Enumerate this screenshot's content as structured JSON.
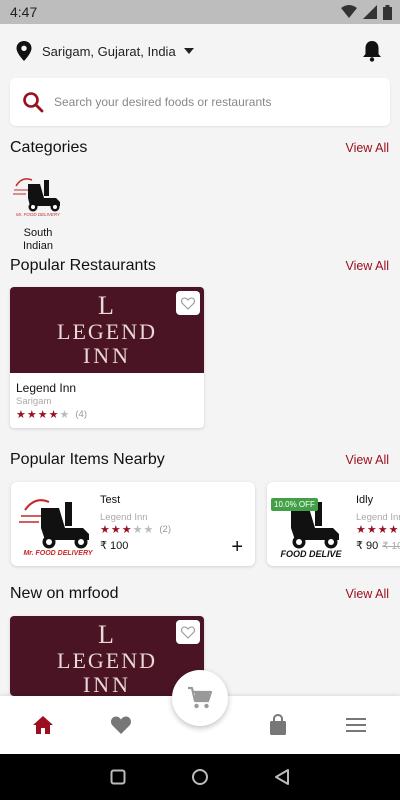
{
  "status": {
    "time": "4:47"
  },
  "header": {
    "location": "Sarigam, Gujarat, India"
  },
  "search": {
    "placeholder": "Search your desired foods or restaurants"
  },
  "sections": {
    "categories": "Categories",
    "popular_restaurants": "Popular Restaurants",
    "popular_items": "Popular Items Nearby",
    "new_on": "New on mrfood",
    "view_all": "View All"
  },
  "categories": [
    {
      "label": "South Indian",
      "logo_text": "Mr. FOOD DELIVERY"
    }
  ],
  "restaurants": [
    {
      "name": "Legend Inn",
      "location": "Sarigam",
      "rating": 3.5,
      "rating_count": "(4)",
      "image_text": [
        "L",
        "LEGEND",
        "INN"
      ]
    }
  ],
  "popular_items": [
    {
      "name": "Test",
      "restaurant": "Legend Inn",
      "rating": 3,
      "rating_count": "(2)",
      "price": "₹ 100",
      "logo_text": "Mr. FOOD DELIVERY"
    },
    {
      "name": "Idly",
      "restaurant": "Legend Inn",
      "rating": 5,
      "price": "₹ 90",
      "old_price": "₹ 10",
      "discount": "10.0% OFF",
      "logo_text": "FOOD DELIVE"
    }
  ],
  "new_on": [
    {
      "image_text": [
        "L",
        "LEGEND",
        "INN"
      ]
    }
  ],
  "colors": {
    "accent": "#9b1020",
    "discount": "#43a047"
  },
  "icons": [
    "location-pin-icon",
    "bell-icon",
    "search-icon",
    "heart-outline-icon",
    "home-icon",
    "heart-icon",
    "cart-icon",
    "bag-icon",
    "menu-icon"
  ]
}
